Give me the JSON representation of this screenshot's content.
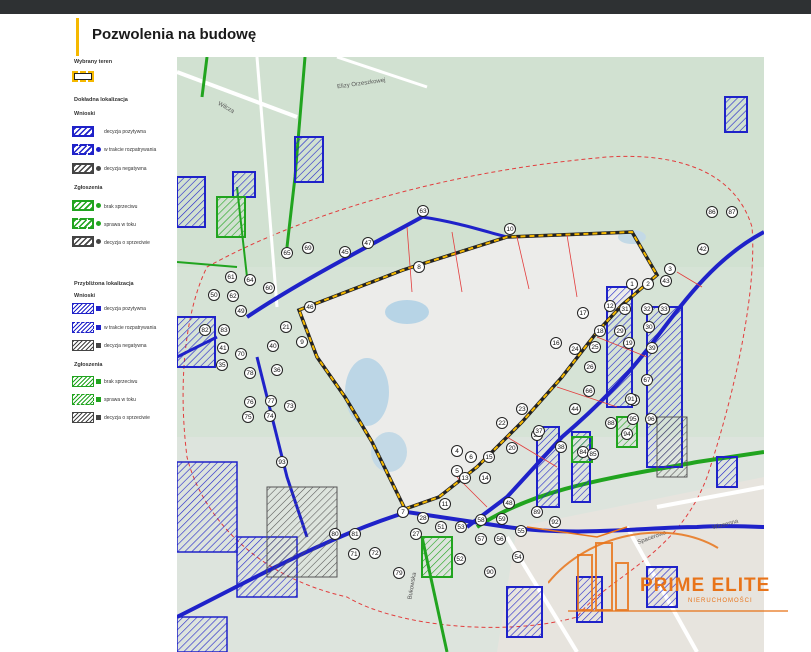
{
  "header": {
    "title": "Pozwolenia na budowę"
  },
  "legend": {
    "parcel_title": "Wybrany teren",
    "exact_title": "Dokładna lokalizacja",
    "approx_title": "Przybliżona lokalizacja",
    "decisions_title": "Wnioski",
    "reports_title": "Zgłoszenia",
    "decisions_title2": "Wnioski",
    "reports_title2": "Zgłoszenia",
    "decision_items": [
      "decyzja pozytywna",
      "w trakcie rozpatrywania",
      "decyzja negatywna"
    ],
    "report_items": [
      "brak sprzeciwu",
      "sprawa w toku",
      "decyzja o sprzeciwie"
    ],
    "decision_items2": [
      "decyzja pozytywna",
      "w trakcie rozpatrywania",
      "decyzja negatywna"
    ],
    "report_items2": [
      "brak sprzeciwu",
      "sprawa w toku",
      "decyzja o sprzeciwie"
    ],
    "colors": {
      "decision": "#1f22c9",
      "report": "#21a41f",
      "negative": "#444444",
      "parcel": "#f5b800"
    }
  },
  "map": {
    "streets": [
      "Wilcza",
      "Elizy Orzeszkowej",
      "Bukowska",
      "Spacerowa",
      "Wiosenna"
    ],
    "pins": [
      "1",
      "2",
      "3",
      "4",
      "5",
      "6",
      "7",
      "8",
      "9",
      "10",
      "11",
      "12",
      "13",
      "14",
      "15",
      "16",
      "17",
      "18",
      "19",
      "20",
      "21",
      "22",
      "23",
      "24",
      "25",
      "26",
      "27",
      "28",
      "29",
      "30",
      "31",
      "32",
      "33",
      "34",
      "35",
      "36",
      "37",
      "38",
      "39",
      "40",
      "41",
      "42",
      "43",
      "44",
      "45",
      "46",
      "47",
      "48",
      "49",
      "50",
      "51",
      "52",
      "53",
      "54",
      "55",
      "56",
      "57",
      "58",
      "59",
      "60",
      "61",
      "62",
      "63",
      "64",
      "65",
      "66",
      "67",
      "68",
      "69",
      "70",
      "71",
      "72",
      "73",
      "74",
      "75",
      "76",
      "77",
      "78",
      "79",
      "80",
      "81",
      "82",
      "83",
      "84",
      "85",
      "86",
      "87",
      "88",
      "89",
      "90",
      "91",
      "92",
      "93",
      "94",
      "95",
      "96"
    ]
  },
  "brand": {
    "name": "PRIME ELITE",
    "tagline": "NIERUCHOMOŚCI"
  }
}
